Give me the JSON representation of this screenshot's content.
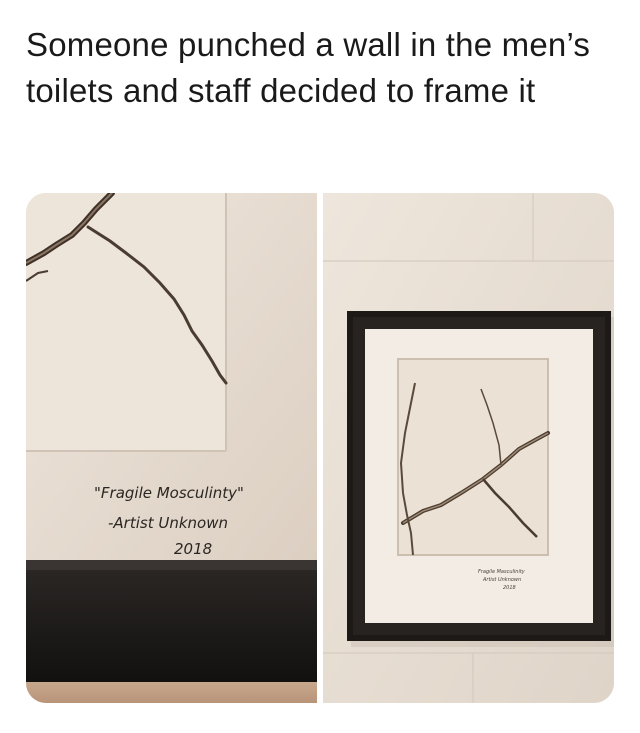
{
  "caption": {
    "text": "Someone punched a wall in the men’s toilets and staff decided to frame it"
  },
  "left_photo": {
    "label_title": "\"Fragile Mosculinty\"",
    "label_artist": "-Artist Unknown",
    "label_year": "2018"
  },
  "right_photo": {
    "mini_label_title": "Fragile Masculinity",
    "mini_label_artist": "Artist Unknown",
    "mini_label_year": "2018"
  },
  "colors": {
    "wall": "#e9e0d6",
    "wall_shadow": "#d8cdc1",
    "frame": "#1c1917",
    "mat": "#f3ece4",
    "crack": "#4a3c30"
  }
}
